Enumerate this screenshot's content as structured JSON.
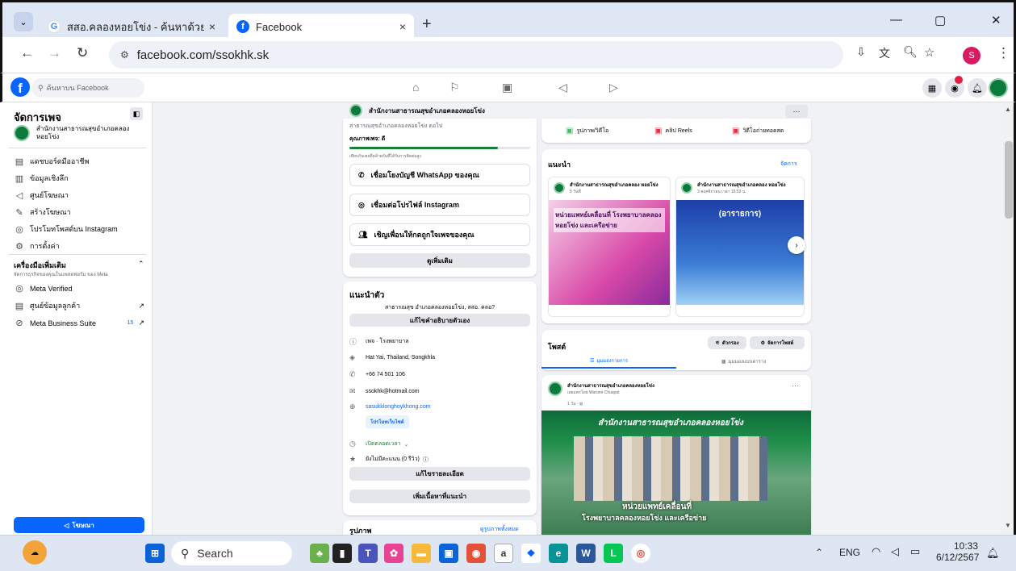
{
  "browser": {
    "tabs": [
      {
        "title": "สสอ.คลองหอยโข่ง - ค้นหาด้วย Goo",
        "close": "×"
      },
      {
        "title": "Facebook",
        "close": "×"
      }
    ],
    "new_tab": "+",
    "url": "facebook.com/ssokhk.sk",
    "profile_initial": "S",
    "window_controls": [
      "—",
      "▢",
      "✕"
    ]
  },
  "fb_header": {
    "search_placeholder": "ค้นหาบน Facebook",
    "notification_count": ""
  },
  "sidebar": {
    "title": "จัดการเพจ",
    "page_name": "สำนักงานสาธารณสุขอำเภอคลอง หอยโข่ง",
    "items": [
      {
        "label": "แดชบอร์ดมืออาชีพ",
        "icon": "dashboard-icon"
      },
      {
        "label": "ข้อมูลเชิงลึก",
        "icon": "insights-icon"
      },
      {
        "label": "ศูนย์โฆษณา",
        "icon": "megaphone-icon"
      },
      {
        "label": "สร้างโฆษณา",
        "icon": "pencil-icon"
      },
      {
        "label": "โปรโมทโพสต์บน Instagram",
        "icon": "instagram-icon"
      },
      {
        "label": "การตั้งค่า",
        "icon": "gear-icon"
      }
    ],
    "tools_title": "เครื่องมือเพิ่มเติม",
    "tools_sub": "จัดการธุรกิจของคุณในแพลตฟอร์ม ของ Meta",
    "tools": [
      {
        "label": "Meta Verified",
        "icon": "verified-icon",
        "badge": ""
      },
      {
        "label": "ศูนย์ข้อมูลลูกค้า",
        "icon": "contacts-icon",
        "badge": ""
      },
      {
        "label": "Meta Business Suite",
        "icon": "meta-icon",
        "badge": "15"
      }
    ],
    "advertise_button": "โฆษณา"
  },
  "page_header": {
    "name": "สำนักงานสาธารณสุขอำเภอคลองหอยโข่ง",
    "more": "···"
  },
  "left_col": {
    "cut_text": "สาธารณสุขอำเภอคลองหอยโข่ง ดอไป",
    "quality_label": "คุณภาพเพจ: ดี",
    "quality_hint": "เทียบกับเพจที่คล้ายกันที่ได้รับการติดต่อสูง",
    "quality_percent": 82,
    "actions": [
      {
        "label": "เชื่อมโยงบัญชี WhatsApp ของคุณ",
        "icon": "whatsapp-icon"
      },
      {
        "label": "เชื่อมต่อโปรไฟล์ Instagram",
        "icon": "instagram-icon"
      },
      {
        "label": "เชิญเพื่อนให้กดถูกใจเพจของคุณ",
        "icon": "people-icon"
      }
    ],
    "see_more": "ดูเพิ่มเติม",
    "intro_title": "แนะนำตัว",
    "intro_text": "สาธารณสุข อำเภอคลองหอยโข่ง, สสอ. คลอ?",
    "edit_bio": "แก้ไขคำอธิบายตัวเอง",
    "info": [
      {
        "icon": "info-icon",
        "text": "เพจ · โรงพยาบาล"
      },
      {
        "icon": "location-icon",
        "text": "Hat Yai, Thailand, Songkhla"
      },
      {
        "icon": "phone-icon",
        "text": "+66 74 501 106"
      },
      {
        "icon": "mail-icon",
        "text": "ssokhk@hotmail.com"
      },
      {
        "icon": "link-icon",
        "text": "sasukklonghoykhong.com"
      }
    ],
    "promote_site": "โปรโมทเว็บไซต์",
    "hours": "เปิดตลอดเวลา",
    "rating": "ยังไม่มีคะแนน (0 รีวิว)",
    "edit_details": "แก้ไขรายละเอียด",
    "add_featured": "เพิ่มเนื้อหาที่แนะนำ",
    "photos_title": "รูปภาพ",
    "photos_all": "ดูรูปภาพทั้งหมด"
  },
  "right_col": {
    "composer": [
      {
        "label": "รูปภาพ/วิดีโอ",
        "color": "#45bd62"
      },
      {
        "label": "คลิป Reels",
        "color": "#f02849"
      },
      {
        "label": "วิดีโอถ่ายทอดสด",
        "color": "#f02849"
      }
    ],
    "recommend_title": "แนะนำ",
    "manage": "จัดการ",
    "rec_posts": [
      {
        "name": "สำนักงานสาธารณสุขอำเภอคลอง หอยโข่ง",
        "time": "5 วันที่",
        "headline": "หน่วยแพทย์เคลื่อนที่ โรงพยาบาลคลองหอยโข่ง และเครือข่าย"
      },
      {
        "name": "สำนักงานสาธารณสุขอำเภอคลอง หอยโข่ง",
        "time": "3 พฤศจิกายน เวลา 15:53 น.",
        "headline": "(อาราธการ)"
      }
    ],
    "posts_title": "โพสต์",
    "filter": "ตัวกรอง",
    "manage_posts": "จัดการโพสต์",
    "view_list": "มุมมองรายการ",
    "view_grid": "มุมมองแบบตาราง",
    "post_author": "สำนักงานสาธารณสุขอำเภอคลองหอยโข่ง",
    "post_by": "เผยแพร่โดย Warune Chuaput",
    "post_time": "1 วัน · ",
    "banner_title": "สำนักงานสาธารณสุขอำเภอคลองหอยโข่ง",
    "banner_caption": "หน่วยแพทย์เคลื่อนที่",
    "banner_caption2": "โรงพยาบาลคลองหอยโข่ง และเครือข่าย"
  },
  "taskbar": {
    "search": "Search",
    "lang": "ENG",
    "time": "10:33",
    "date": "6/12/2567"
  },
  "colors": {
    "fb_blue": "#0866ff",
    "green": "#0b7a3e"
  }
}
